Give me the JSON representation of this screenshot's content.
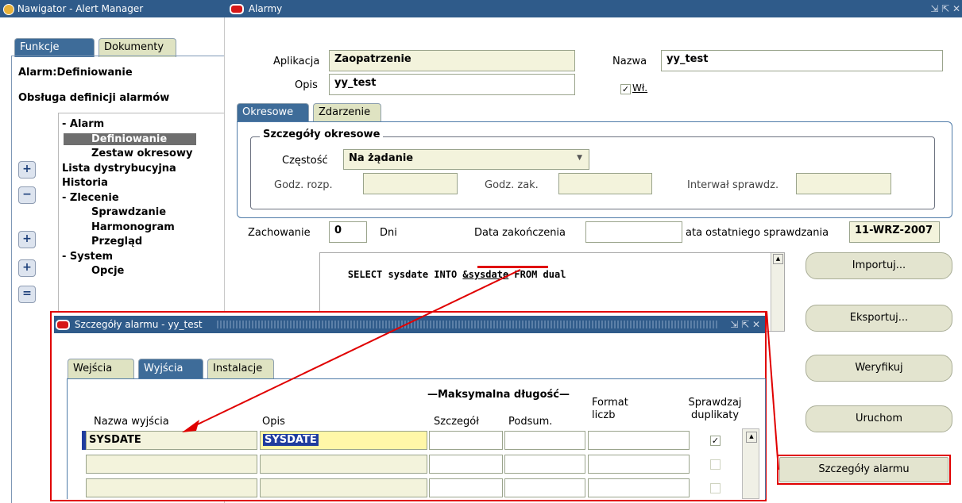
{
  "navigator": {
    "title": "Nawigator - Alert Manager",
    "tabs": [
      "Funkcje",
      "Dokumenty"
    ],
    "heading1": "Alarm:Definiowanie",
    "heading2": "Obsługa definicji alarmów",
    "tree": [
      {
        "label": "- Alarm",
        "level": 0
      },
      {
        "label": "Definiowanie",
        "level": 1,
        "selected": true
      },
      {
        "label": "Zestaw okresowy",
        "level": 1
      },
      {
        "label": "Lista dystrybucyjna",
        "level": 0
      },
      {
        "label": "Historia",
        "level": 0
      },
      {
        "label": "- Zlecenie",
        "level": 0
      },
      {
        "label": "Sprawdzanie",
        "level": 1
      },
      {
        "label": "Harmonogram",
        "level": 1
      },
      {
        "label": "Przegląd",
        "level": 1
      },
      {
        "label": "- System",
        "level": 0
      },
      {
        "label": "Opcje",
        "level": 1
      }
    ],
    "side_buttons": [
      "+",
      "−",
      "+",
      "+",
      "="
    ]
  },
  "alarmy": {
    "title": "Alarmy",
    "aplikacja_label": "Aplikacja",
    "aplikacja_value": "Zaopatrzenie",
    "nazwa_label": "Nazwa",
    "nazwa_value": "yy_test",
    "opis_label": "Opis",
    "opis_value": "yy_test",
    "wl_label": "Wł.",
    "wl_checked": true,
    "tabs": [
      "Okresowe",
      "Zdarzenie"
    ],
    "section_title": "Szczegóły okresowe",
    "czestosc_label": "Częstość",
    "czestosc_value": "Na żądanie",
    "godz_rozp_label": "Godz. rozp.",
    "godz_zak_label": "Godz. zak.",
    "interwal_label": "Interwał sprawdz.",
    "zachowanie_label": "Zachowanie",
    "zachowanie_value": "0",
    "dni_label": "Dni",
    "data_zak_label": "Data zakończenia",
    "data_ostatniego_label": "ata ostatniego sprawdzania",
    "data_ostatniego_value": "11-WRZ-2007",
    "sql_prefix": "SELECT sysdate INTO ",
    "sql_var": "&sysdate",
    "sql_suffix": " FROM dual",
    "buttons": [
      "Importuj...",
      "Eksportuj...",
      "Weryfikuj",
      "Uruchom",
      "Szczegóły alarmu"
    ]
  },
  "szczegoly": {
    "title": "Szczegóły alarmu - yy_test",
    "tabs": [
      "Wejścia",
      "Wyjścia",
      "Instalacje"
    ],
    "group_header": "Maksymalna długość",
    "columns": {
      "nazwa": "Nazwa wyjścia",
      "opis": "Opis",
      "szczegol": "Szczegół",
      "podsum": "Podsum.",
      "format": "Format liczb",
      "sprawdzaj": "Sprawdzaj duplikaty"
    },
    "rows": [
      {
        "nazwa": "SYSDATE",
        "opis": "SYSDATE",
        "checked": true
      },
      {
        "nazwa": "",
        "opis": "",
        "checked": false
      },
      {
        "nazwa": "",
        "opis": "",
        "checked": false
      }
    ]
  },
  "colors": {
    "titlebar": "#2f5b8a",
    "highlight_red": "#e00000",
    "selected_item": "#6e6e6e"
  }
}
